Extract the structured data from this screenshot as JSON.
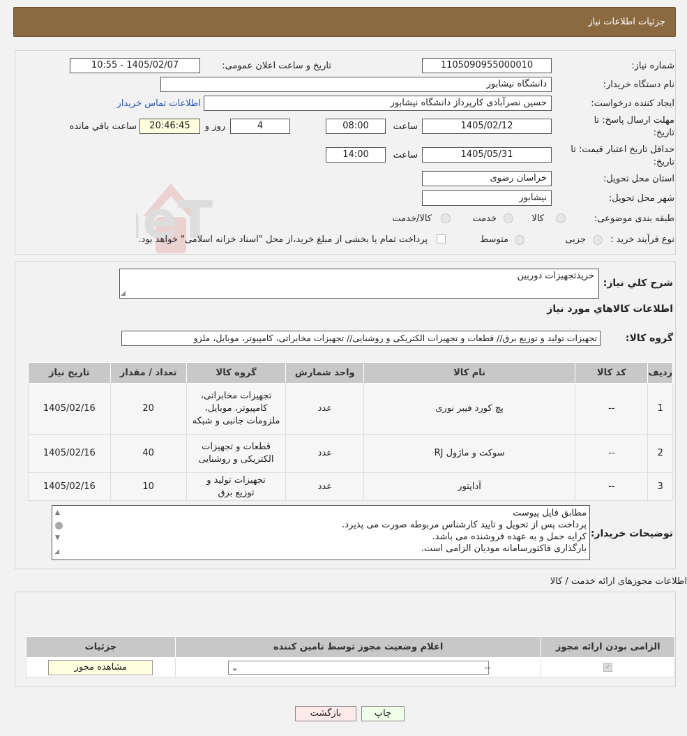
{
  "header": {
    "title": "جزئیات اطلاعات نیاز"
  },
  "form": {
    "need_number_label": "شماره نیاز:",
    "need_number": "1105090955000010",
    "announce_label": "تاریخ و ساعت اعلان عمومی:",
    "announce_value": "1405/02/07 - 10:55",
    "buyer_org_label": "نام دستگاه خریدار:",
    "buyer_org": "دانشگاه نیشابور",
    "requester_label": "ایجاد کننده درخواست:",
    "requester": "حسین نصرآبادی کارپرداز دانشگاه نیشابور",
    "contact_link": "اطلاعات تماس خریدار",
    "deadline_label": "مهلت ارسال پاسخ: تا تاریخ:",
    "deadline_date": "1405/02/12",
    "time_label": "ساعت",
    "deadline_time": "08:00",
    "days_count": "4",
    "days_label": "روز و",
    "remaining_time": "20:46:45",
    "remaining_label": "ساعت باقي مانده",
    "validity_label": "حداقل تاریخ اعتبار قیمت: تا تاریخ:",
    "validity_date": "1405/05/31",
    "validity_time": "14:00",
    "province_label": "استان محل تحویل:",
    "province": "خراسان رضوی",
    "city_label": "شهر محل تحویل:",
    "city": "نیشابور",
    "category_label": "طبقه بندی موضوعی:",
    "category_options": [
      "کالا",
      "خدمت",
      "کالا/خدمت"
    ],
    "process_label": "نوع فرآیند خرید :",
    "process_options": [
      "جزیی",
      "متوسط"
    ],
    "payment_note": "پرداخت تمام یا بخشی از مبلغ خرید،از محل \"اسناد خزانه اسلامی\" خواهد بود."
  },
  "watermark": "AriaTender.neT",
  "summary": {
    "desc_label": "شرح كلي نياز:",
    "desc": "خریدتجهیزات دوربین",
    "goods_info_title": "اطلاعات کالاهاي مورد نياز",
    "group_label": "گروه کالا:",
    "group_value": "تجهیزات تولید و توزیع برق// قطعات و تجهیزات الکتریکی و روشنایی// تجهیزات مخابراتی، کامپیوتر، موبایل، ملزو"
  },
  "goods_table": {
    "headers": [
      "ردیف",
      "کد کالا",
      "نام کالا",
      "واحد شمارش",
      "گروه کالا",
      "تعداد / مقدار",
      "تاریخ نیاز"
    ],
    "rows": [
      [
        "1",
        "--",
        "پچ کورد فیبر نوری",
        "عدد",
        "تجهیزات مخابراتی، کامپیوتر، موبایل، ملزومات جانبی و شبکه",
        "20",
        "1405/02/16"
      ],
      [
        "2",
        "--",
        "سوکت و ماژول RJ",
        "عدد",
        "قطعات و تجهیزات الکتریکی و روشنایی",
        "40",
        "1405/02/16"
      ],
      [
        "3",
        "--",
        "آداپتور",
        "عدد",
        "تجهیزات تولید و توزیع برق",
        "10",
        "1405/02/16"
      ]
    ]
  },
  "buyer_notes": {
    "label": "توضیحات خریدار:",
    "lines": [
      "مطابق فایل پیوست",
      "پرداخت پس از تحویل و تایید کارشناس مربوطه صورت می پذیرد.",
      "کرایه حمل و به عهده فروشنده می باشد.",
      "بارگذاری فاکتورسامانه مودیان الزامی است."
    ]
  },
  "permits": {
    "title": "اطلاعات مجوزهای ارائه خدمت / کالا",
    "headers": [
      "الزامی بودن ارائه مجوز",
      "اعلام وضعیت مجوز توسط تامین کننده",
      "جزئیات"
    ],
    "status_value": "--",
    "view_button": "مشاهده مجوز"
  },
  "buttons": {
    "print": "چاپ",
    "back": "بازگشت"
  }
}
